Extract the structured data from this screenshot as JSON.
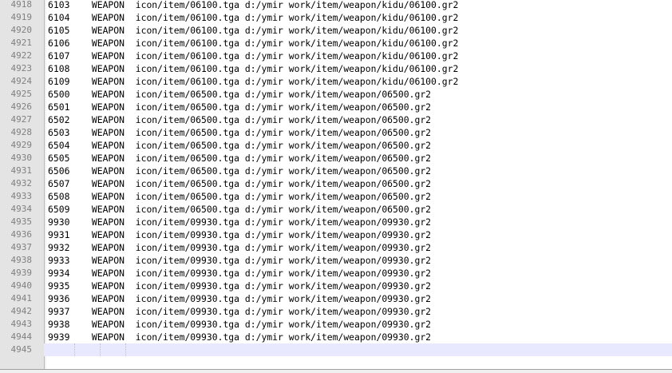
{
  "editor": {
    "lines": [
      {
        "ln": "4918",
        "text": "6103    WEAPON  icon/item/06100.tga d:/ymir work/item/weapon/kidu/06100.gr2"
      },
      {
        "ln": "4919",
        "text": "6104    WEAPON  icon/item/06100.tga d:/ymir work/item/weapon/kidu/06100.gr2"
      },
      {
        "ln": "4920",
        "text": "6105    WEAPON  icon/item/06100.tga d:/ymir work/item/weapon/kidu/06100.gr2"
      },
      {
        "ln": "4921",
        "text": "6106    WEAPON  icon/item/06100.tga d:/ymir work/item/weapon/kidu/06100.gr2"
      },
      {
        "ln": "4922",
        "text": "6107    WEAPON  icon/item/06100.tga d:/ymir work/item/weapon/kidu/06100.gr2"
      },
      {
        "ln": "4923",
        "text": "6108    WEAPON  icon/item/06100.tga d:/ymir work/item/weapon/kidu/06100.gr2"
      },
      {
        "ln": "4924",
        "text": "6109    WEAPON  icon/item/06100.tga d:/ymir work/item/weapon/kidu/06100.gr2"
      },
      {
        "ln": "4925",
        "text": "6500    WEAPON  icon/item/06500.tga d:/ymir work/item/weapon/06500.gr2"
      },
      {
        "ln": "4926",
        "text": "6501    WEAPON  icon/item/06500.tga d:/ymir work/item/weapon/06500.gr2"
      },
      {
        "ln": "4927",
        "text": "6502    WEAPON  icon/item/06500.tga d:/ymir work/item/weapon/06500.gr2"
      },
      {
        "ln": "4928",
        "text": "6503    WEAPON  icon/item/06500.tga d:/ymir work/item/weapon/06500.gr2"
      },
      {
        "ln": "4929",
        "text": "6504    WEAPON  icon/item/06500.tga d:/ymir work/item/weapon/06500.gr2"
      },
      {
        "ln": "4930",
        "text": "6505    WEAPON  icon/item/06500.tga d:/ymir work/item/weapon/06500.gr2"
      },
      {
        "ln": "4931",
        "text": "6506    WEAPON  icon/item/06500.tga d:/ymir work/item/weapon/06500.gr2"
      },
      {
        "ln": "4932",
        "text": "6507    WEAPON  icon/item/06500.tga d:/ymir work/item/weapon/06500.gr2"
      },
      {
        "ln": "4933",
        "text": "6508    WEAPON  icon/item/06500.tga d:/ymir work/item/weapon/06500.gr2"
      },
      {
        "ln": "4934",
        "text": "6509    WEAPON  icon/item/06500.tga d:/ymir work/item/weapon/06500.gr2"
      },
      {
        "ln": "4935",
        "text": "9930    WEAPON  icon/item/09930.tga d:/ymir work/item/weapon/09930.gr2"
      },
      {
        "ln": "4936",
        "text": "9931    WEAPON  icon/item/09930.tga d:/ymir work/item/weapon/09930.gr2"
      },
      {
        "ln": "4937",
        "text": "9932    WEAPON  icon/item/09930.tga d:/ymir work/item/weapon/09930.gr2"
      },
      {
        "ln": "4938",
        "text": "9933    WEAPON  icon/item/09930.tga d:/ymir work/item/weapon/09930.gr2"
      },
      {
        "ln": "4939",
        "text": "9934    WEAPON  icon/item/09930.tga d:/ymir work/item/weapon/09930.gr2"
      },
      {
        "ln": "4940",
        "text": "9935    WEAPON  icon/item/09930.tga d:/ymir work/item/weapon/09930.gr2"
      },
      {
        "ln": "4941",
        "text": "9936    WEAPON  icon/item/09930.tga d:/ymir work/item/weapon/09930.gr2"
      },
      {
        "ln": "4942",
        "text": "9937    WEAPON  icon/item/09930.tga d:/ymir work/item/weapon/09930.gr2"
      },
      {
        "ln": "4943",
        "text": "9938    WEAPON  icon/item/09930.tga d:/ymir work/item/weapon/09930.gr2"
      },
      {
        "ln": "4944",
        "text": "9939    WEAPON  icon/item/09930.tga d:/ymir work/item/weapon/09930.gr2"
      },
      {
        "ln": "4945",
        "text": ""
      }
    ],
    "current_line": "4945",
    "colors": {
      "gutter": "#e4e4e4",
      "line_number": "#808080",
      "current_line_highlight": "#e8e8ff"
    }
  }
}
